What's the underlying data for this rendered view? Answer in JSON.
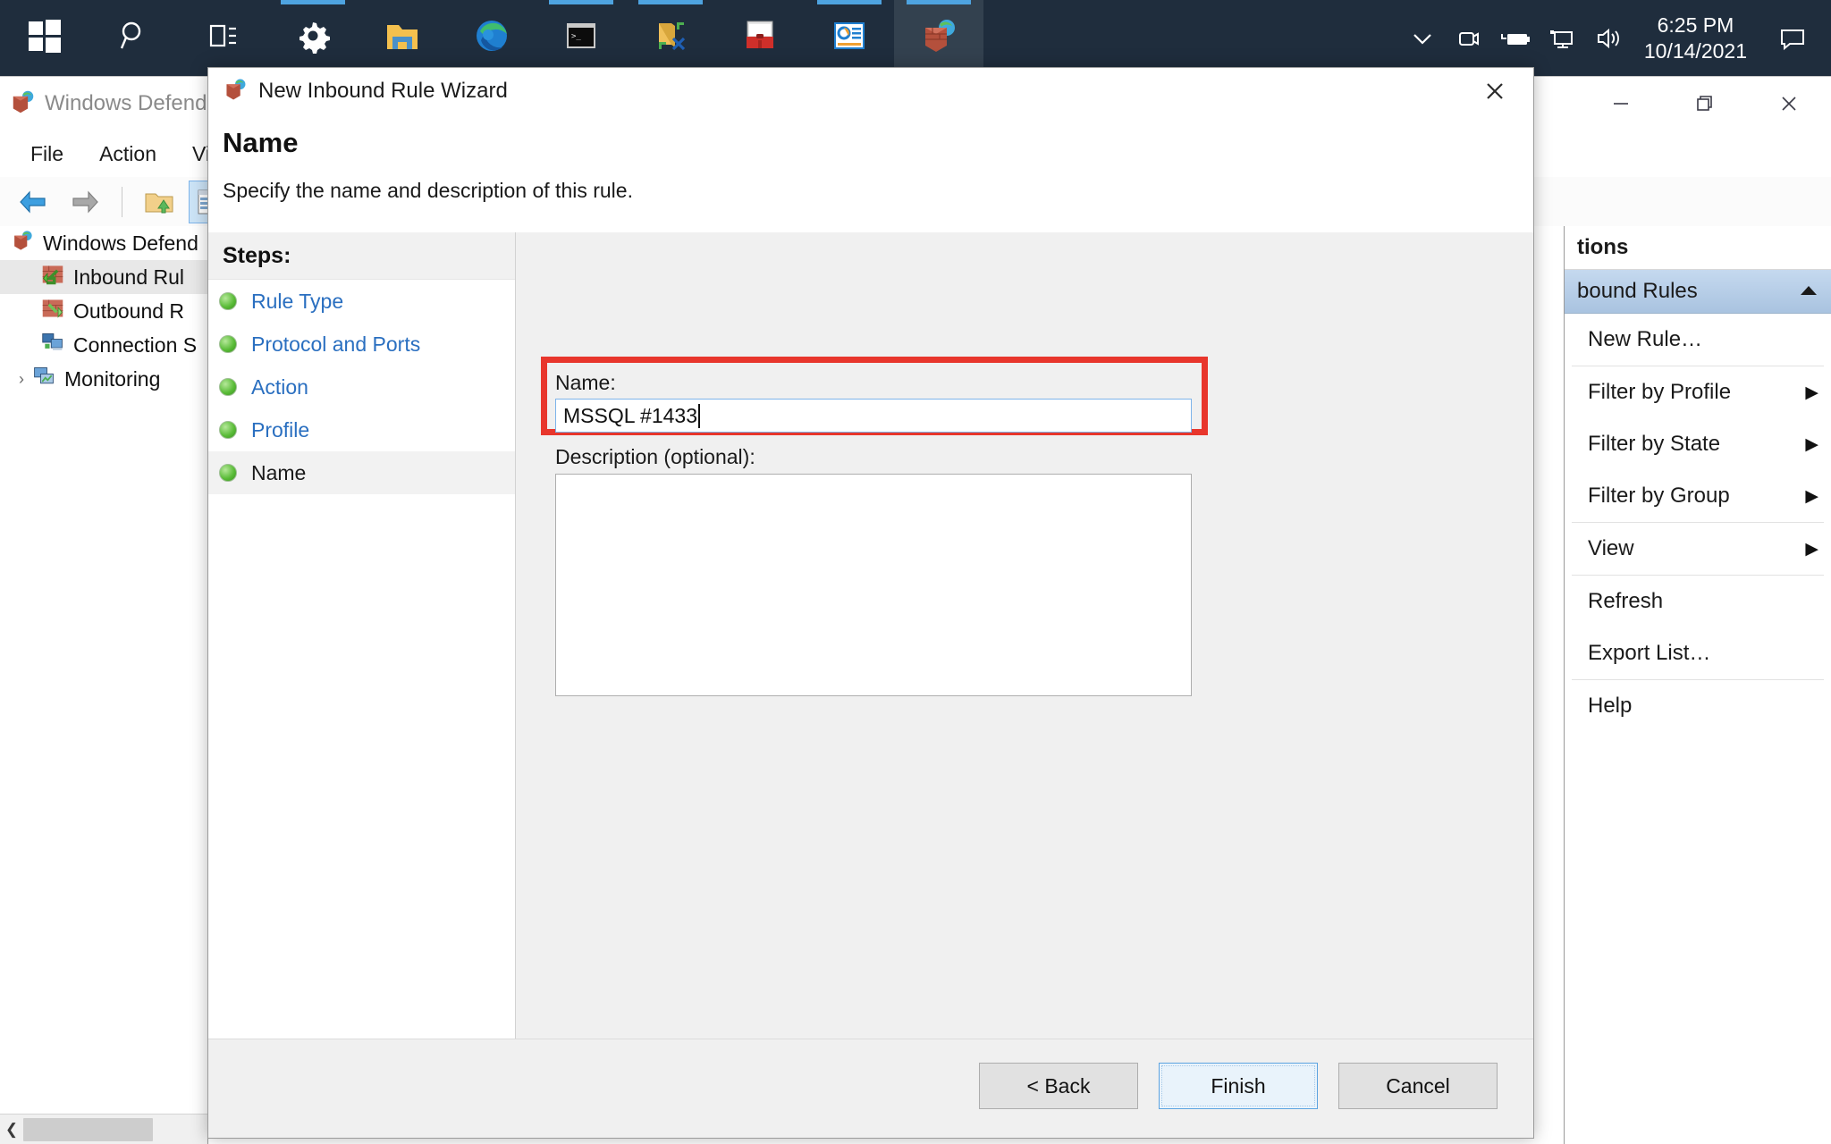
{
  "taskbar": {
    "start_label": "Start",
    "apps": [
      {
        "name": "start-button",
        "icon": "windows-logo-icon",
        "active": false,
        "running": false
      },
      {
        "name": "search-button",
        "icon": "search-icon",
        "active": false,
        "running": false
      },
      {
        "name": "task-view-button",
        "icon": "task-view-icon",
        "active": false,
        "running": false
      },
      {
        "name": "settings-app",
        "icon": "gear-icon",
        "active": false,
        "running": true
      },
      {
        "name": "file-explorer-app",
        "icon": "folder-icon",
        "active": false,
        "running": false
      },
      {
        "name": "edge-browser-app",
        "icon": "edge-icon",
        "active": false,
        "running": false
      },
      {
        "name": "terminal-app",
        "icon": "terminal-icon",
        "active": false,
        "running": true
      },
      {
        "name": "sql-tools-app",
        "icon": "sql-tools-icon",
        "active": false,
        "running": true
      },
      {
        "name": "toolbox-app",
        "icon": "toolbox-icon",
        "active": false,
        "running": false
      },
      {
        "name": "server-manager-app",
        "icon": "server-manager-icon",
        "active": false,
        "running": true
      },
      {
        "name": "windows-firewall-app",
        "icon": "firewall-brick-icon",
        "active": true,
        "running": true
      }
    ],
    "tray": [
      {
        "name": "show-hidden-icons",
        "icon": "chevron-up-icon"
      },
      {
        "name": "camera-tray-icon",
        "icon": "camera-icon"
      },
      {
        "name": "battery-tray-icon",
        "icon": "battery-icon"
      },
      {
        "name": "network-tray-icon",
        "icon": "monitor-network-icon"
      },
      {
        "name": "volume-tray-icon",
        "icon": "speaker-icon"
      }
    ],
    "clock": {
      "time": "6:25 PM",
      "date": "10/14/2021"
    },
    "action_center_label": "Action Center"
  },
  "mmc": {
    "title": "Windows Defend",
    "title_icon": "firewall-brick-icon",
    "window_controls": {
      "minimize": "—",
      "restore": "restore",
      "close": "✕"
    },
    "menu": [
      "File",
      "Action",
      "Vie"
    ],
    "toolbar": [
      {
        "name": "back-button",
        "icon": "back-arrow-icon"
      },
      {
        "name": "forward-button",
        "icon": "forward-arrow-icon"
      },
      {
        "name": "up-folder-button",
        "icon": "folder-up-icon"
      },
      {
        "name": "show-hide-console-tree-button",
        "icon": "console-tree-icon",
        "selected": true
      }
    ],
    "tree": [
      {
        "label": "Windows Defend",
        "icon": "firewall-brick-icon",
        "indent": 0,
        "selected": false,
        "chevron": ""
      },
      {
        "label": "Inbound Rul",
        "icon": "inbound-rules-icon",
        "indent": 1,
        "selected": true,
        "chevron": ""
      },
      {
        "label": "Outbound R",
        "icon": "outbound-rules-icon",
        "indent": 1,
        "selected": false,
        "chevron": ""
      },
      {
        "label": "Connection S",
        "icon": "connection-security-icon",
        "indent": 1,
        "selected": false,
        "chevron": ""
      },
      {
        "label": "Monitoring",
        "icon": "monitoring-icon",
        "indent": 1,
        "selected": false,
        "chevron": "›"
      }
    ],
    "actions": {
      "header": "tions",
      "group_title": "bound Rules",
      "group_collapse_icon": "chevron-up-icon",
      "items": [
        {
          "label": "New Rule…",
          "submenu": false
        },
        {
          "label": "Filter by Profile",
          "submenu": true
        },
        {
          "label": "Filter by State",
          "submenu": true
        },
        {
          "label": "Filter by Group",
          "submenu": true
        },
        {
          "label": "View",
          "submenu": true
        },
        {
          "label": "Refresh",
          "submenu": false
        },
        {
          "label": "Export List…",
          "submenu": false
        },
        {
          "label": "Help",
          "submenu": false
        }
      ],
      "submenu_arrow": "▶"
    }
  },
  "wizard": {
    "title": "New Inbound Rule Wizard",
    "title_icon": "firewall-brick-icon",
    "close_label": "✕",
    "heading": "Name",
    "subheading": "Specify the name and description of this rule.",
    "steps_header": "Steps:",
    "steps": [
      {
        "label": "Rule Type",
        "current": false
      },
      {
        "label": "Protocol and Ports",
        "current": false
      },
      {
        "label": "Action",
        "current": false
      },
      {
        "label": "Profile",
        "current": false
      },
      {
        "label": "Name",
        "current": true
      }
    ],
    "form": {
      "name_label": "Name:",
      "name_value": "MSSQL #1433",
      "name_placeholder": "",
      "description_label": "Description (optional):",
      "description_value": "",
      "description_placeholder": ""
    },
    "buttons": {
      "back": "< Back",
      "finish": "Finish",
      "cancel": "Cancel"
    },
    "highlight_color": "#e8362c"
  }
}
